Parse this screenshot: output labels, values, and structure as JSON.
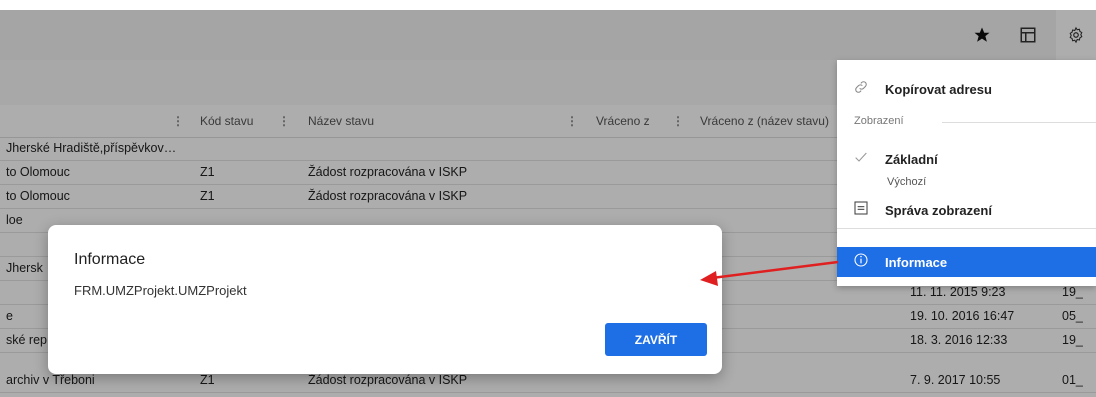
{
  "toolbar": {
    "star_icon": "star-icon",
    "layout_icon": "layout-icon",
    "gear_icon": "gear-icon"
  },
  "table": {
    "headers": {
      "kod_stavu": "Kód stavu",
      "nazev_stavu": "Název stavu",
      "vraceno_z": "Vráceno z",
      "vraceno_z_nazev": "Vráceno z (název stavu)"
    },
    "rows": [
      {
        "col1": "Jherské Hradiště,příspěvkov…",
        "kod": "",
        "nazev": "",
        "datum": "",
        "last": ""
      },
      {
        "col1": "to Olomouc",
        "kod": "Z1",
        "nazev": "Žádost rozpracována v ISKP",
        "datum": "",
        "last": ""
      },
      {
        "col1": "to Olomouc",
        "kod": "Z1",
        "nazev": "Žádost rozpracována v ISKP",
        "datum": "",
        "last": ""
      },
      {
        "col1": "loe",
        "kod": "",
        "nazev": "",
        "datum": "",
        "last": ""
      },
      {
        "col1": "",
        "kod": "",
        "nazev": "",
        "datum": "",
        "last": ""
      },
      {
        "col1": "Jhersk",
        "kod": "",
        "nazev": "",
        "datum": "",
        "last": ""
      },
      {
        "col1": "",
        "kod": "",
        "nazev": "",
        "datum": "11. 11. 2015 9:23",
        "last": "19_"
      },
      {
        "col1": "e",
        "kod": "",
        "nazev": "",
        "datum": "19. 10. 2016 16:47",
        "last": "05_"
      },
      {
        "col1": "ské rep",
        "kod": "",
        "nazev": "",
        "datum": "18. 3. 2016 12:33",
        "last": "19_"
      },
      {
        "col1": "archiv v Třeboni",
        "kod": "Z1",
        "nazev": "Žádost rozpracována v ISKP",
        "datum": "7. 9. 2017 10:55",
        "last": "01_"
      }
    ]
  },
  "menu": {
    "copy_address": "Kopírovat adresu",
    "section_label": "Zobrazení",
    "zakladni": "Základní",
    "vychozi": "Výchozí",
    "sprava": "Správa zobrazení",
    "informace": "Informace"
  },
  "modal": {
    "title": "Informace",
    "text": "FRM.UMZProjekt.UMZProjekt",
    "close_label": "ZAVŘÍT"
  },
  "colors": {
    "accent": "#1e6ee6",
    "arrow": "#e02020"
  }
}
